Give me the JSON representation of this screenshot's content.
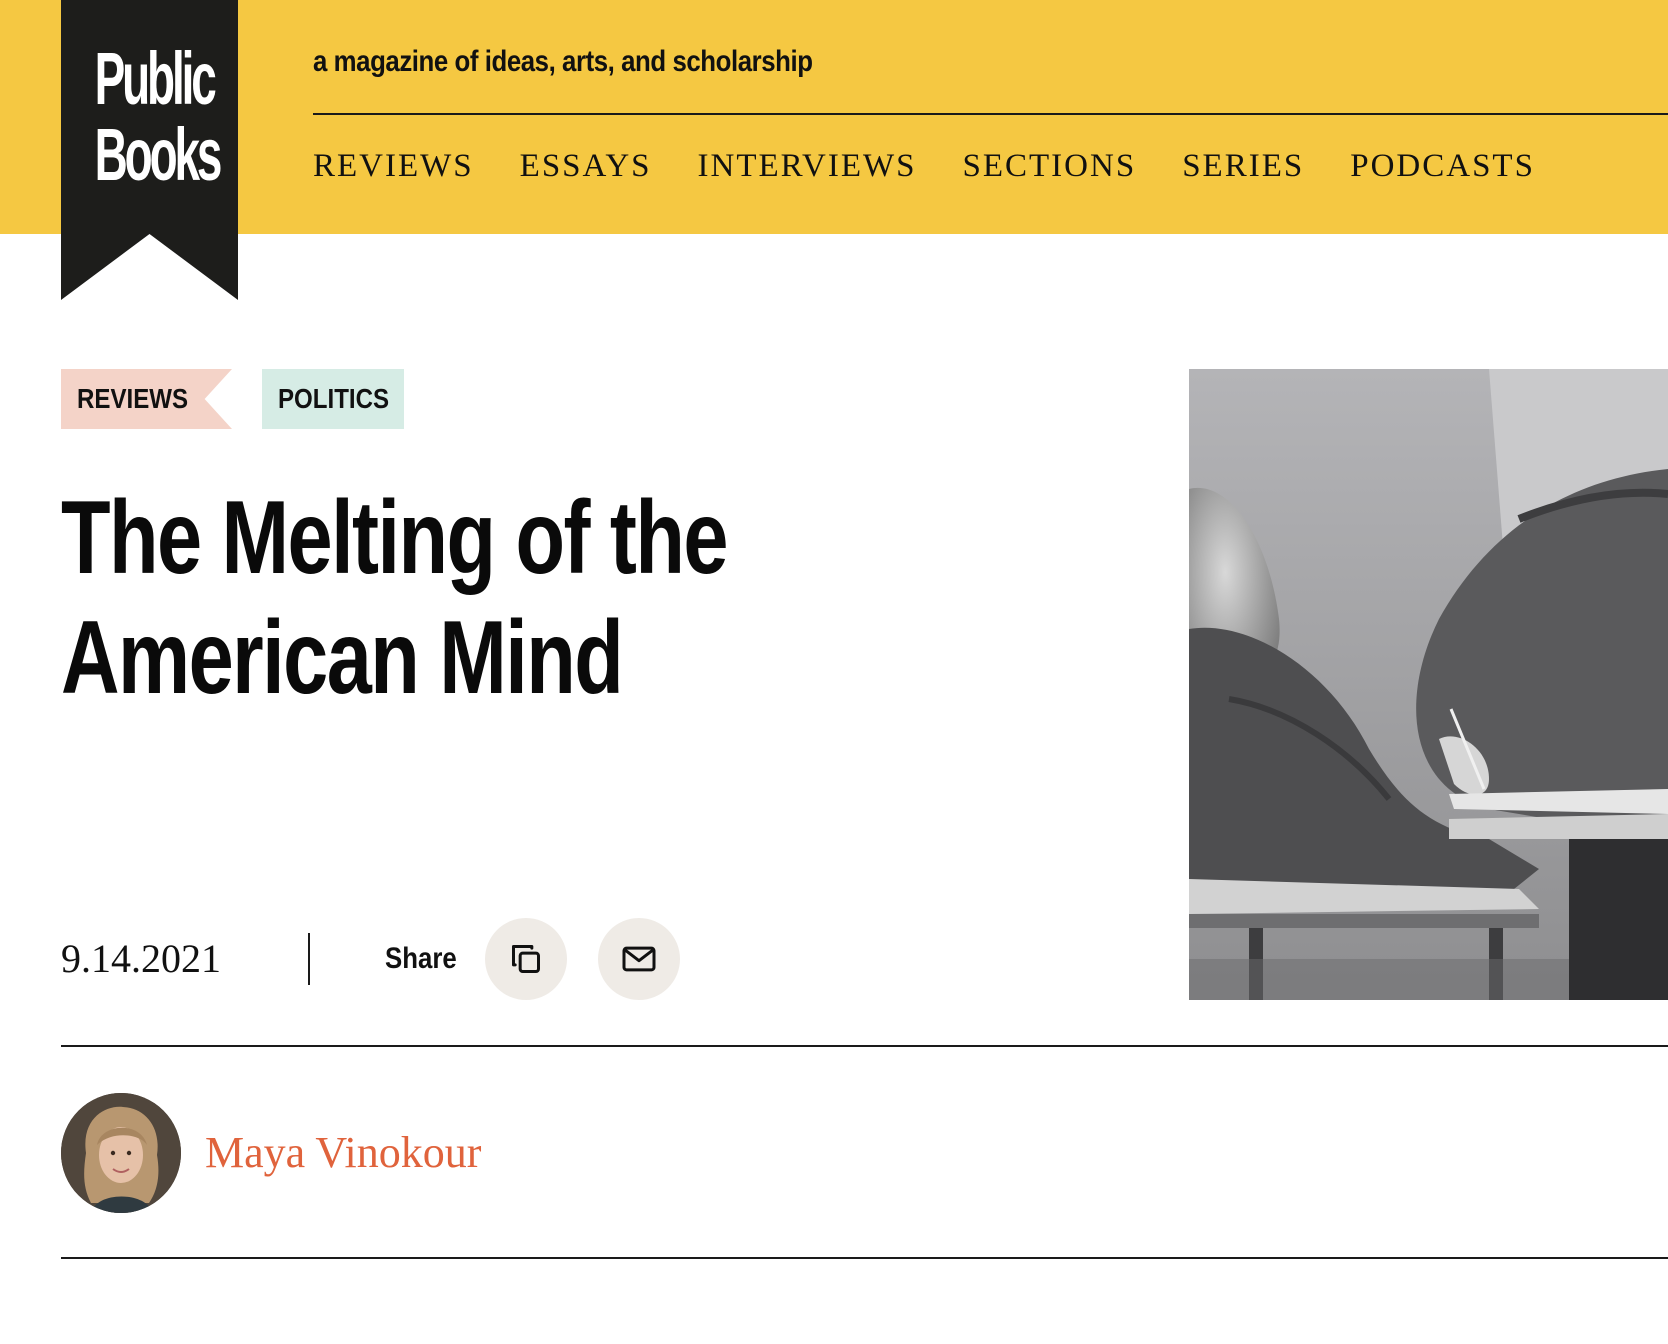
{
  "site": {
    "logo_line1": "Public",
    "logo_line2": "Books",
    "tagline": "a magazine of ideas, arts, and scholarship"
  },
  "nav": {
    "items": [
      {
        "label": "REVIEWS"
      },
      {
        "label": "ESSAYS"
      },
      {
        "label": "INTERVIEWS"
      },
      {
        "label": "SECTIONS"
      },
      {
        "label": "SERIES"
      },
      {
        "label": "PODCASTS"
      }
    ]
  },
  "article": {
    "tags": [
      {
        "label": "REVIEWS",
        "color": "#f4d3c8"
      },
      {
        "label": "POLITICS",
        "color": "#d6ece5"
      }
    ],
    "title_line1": "The Melting of the",
    "title_line2": "American Mind",
    "date": "9.14.2021",
    "share_label": "Share",
    "share_buttons": [
      {
        "icon": "copy-link-icon"
      },
      {
        "icon": "email-icon"
      }
    ],
    "author": "Maya Vinokour"
  },
  "colors": {
    "header_background": "#f5c842",
    "logo_background": "#1d1d1b",
    "author_link": "#e0633c",
    "share_button_background": "#efebe6"
  }
}
